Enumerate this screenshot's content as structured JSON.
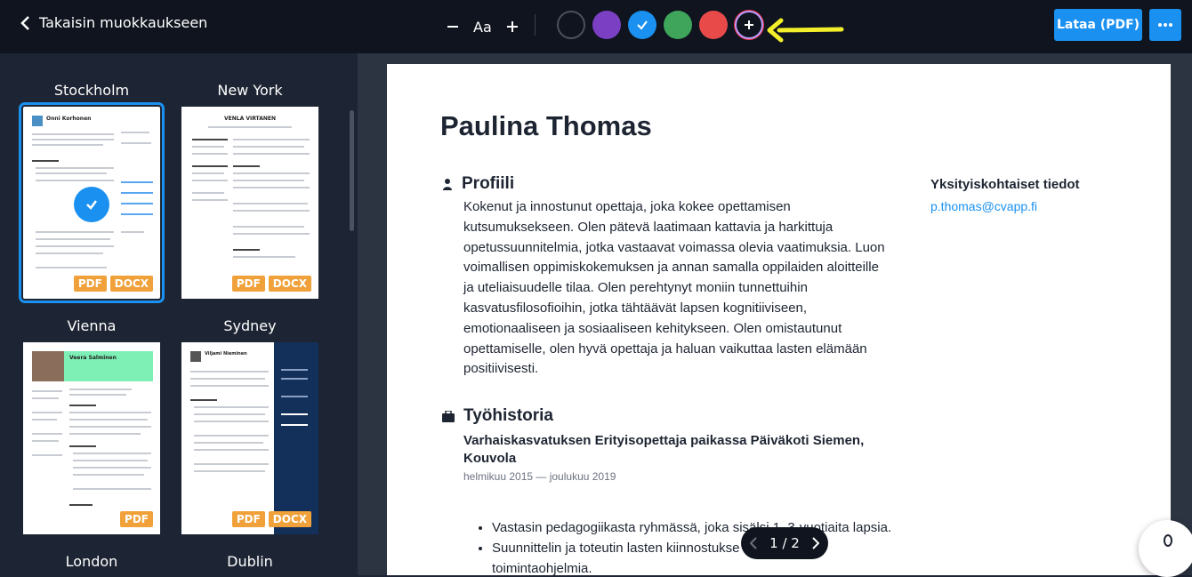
{
  "topbar": {
    "back_label": "Takaisin muokkaukseen",
    "font_label": "Aa",
    "download_label": "Lataa (PDF)",
    "colors": [
      "#0f141e",
      "#7b3fc4",
      "#1a91f0",
      "#3ea55b",
      "#e84a4a"
    ],
    "selected_color": "#1a91f0"
  },
  "templates": [
    {
      "name": "Stockholm",
      "badges": [
        "PDF",
        "DOCX"
      ],
      "selected": true,
      "thumb_name": "Onni Korhonen"
    },
    {
      "name": "New York",
      "badges": [
        "PDF",
        "DOCX"
      ],
      "selected": false,
      "thumb_name": "VENLA VIRTANEN"
    },
    {
      "name": "Vienna",
      "badges": [
        "PDF"
      ],
      "selected": false,
      "thumb_name": "Veera Salminen"
    },
    {
      "name": "Sydney",
      "badges": [
        "PDF",
        "DOCX"
      ],
      "selected": false,
      "thumb_name": "Viljami Nieminen"
    },
    {
      "name": "London"
    },
    {
      "name": "Dublin"
    }
  ],
  "resume": {
    "name": "Paulina Thomas",
    "profile_heading": "Profiili",
    "profile_text": "Kokenut ja innostunut opettaja, joka kokee opettamisen kutsumuksekseen. Olen pätevä laatimaan kattavia ja harkittuja opetussuunnitelmia, jotka vastaavat voimassa olevia vaatimuksia. Luon voimallisen oppimiskokemuksen ja annan samalla oppilaiden aloitteille ja uteliaisuudelle tilaa. Olen perehtynyt moniin tunnettuihin kasvatusfilosofioihin, jotka tähtäävät lapsen kognitiiviseen, emotionaaliseen ja sosiaaliseen kehitykseen. Olen omistautunut opettamiselle, olen hyvä opettaja ja haluan vaikuttaa lasten elämään positiivisesti.",
    "work_heading": "Työhistoria",
    "job_title": "Varhaiskasvatuksen Erityisopettaja paikassa Päiväkoti Siemen, Kouvola",
    "job_dates": "helmikuu 2015 — joulukuu 2019",
    "bullets": [
      "Vastasin pedagogiikasta ryhmässä, joka sisälsi 1–3-vuotiaita lapsia.",
      "Suunnittelin ja toteutin lasten kiinnostukse",
      "toimintaohjelmia."
    ],
    "personal_heading": "Yksityiskohtaiset tiedot",
    "email": "p.thomas@cvapp.fi"
  },
  "pager": {
    "label": "1 / 2"
  }
}
